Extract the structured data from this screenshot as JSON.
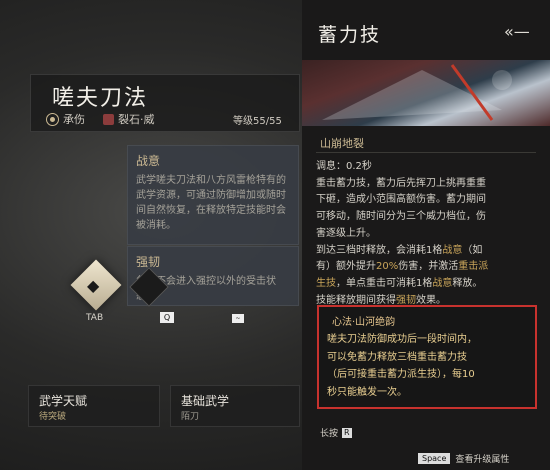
{
  "skill": {
    "title": "嗟夫刀法",
    "attr1": "承伤",
    "attr2": "裂石·威",
    "level": "等级55/55"
  },
  "tooltips": [
    {
      "heading": "战意",
      "body": "武学嗟夫刀法和八方风雷枪特有的武学资源，可通过防御增加或随时间自然恢复，在释放特定技能时会被消耗。"
    },
    {
      "heading": "强韧",
      "body": "角色不会进入强控以外的受击状态。"
    }
  ],
  "keys": {
    "tab": "TAB",
    "q": "Q",
    "tilde": "~"
  },
  "cards": [
    {
      "title": "武学天赋",
      "sub": "待突破"
    },
    {
      "title": "基础武学",
      "sub": "陌刀"
    }
  ],
  "panel": {
    "heading": "蓄力技",
    "section": "山崩地裂",
    "lines": [
      "调息：0.2秒",
      "重击蓄力技，蓄力后先挥刀上挑再重重下砸，造成小范围高额伤害。蓄力期间可移动，随时间分为三个威力档位，伤害逐级上升。",
      "到达三档时释放，会消耗1格战意（如有）额外提升20%伤害，并激活重击派生技，单点重击可消耗1格战意释放。",
      "技能释放期间获得强韧效果。"
    ],
    "rows": [
      [
        "调息：0.2秒"
      ],
      [
        "重击蓄力技，蓄力后先挥刀上挑再重重"
      ],
      [
        "下砸，造成小范围高额伤害。蓄力期间"
      ],
      [
        "可移动，随时间分为三个威力档位，伤"
      ],
      [
        "害逐级上升。"
      ],
      [
        "到达三档时释放，会消耗1格",
        "战意",
        "（如"
      ],
      [
        "有）额外提升",
        "20%",
        "伤害，并激活",
        "重击派"
      ],
      [
        "生技",
        "，单点重击可消耗1格",
        "战意",
        "释放。"
      ],
      [
        "技能释放期间获得",
        "强韧",
        "效果。"
      ]
    ],
    "highlight_color": "#c9a55a"
  },
  "mindset": {
    "title": "心法·山河绝韵",
    "lines": [
      "嗟夫刀法防御成功后一段时间内，",
      "可以免蓄力释放三档重击蓄力技",
      "（后可接重击蓄力派生技），每10",
      "秒只能触发一次。"
    ]
  },
  "longpress": {
    "label": "长按",
    "key": "R"
  },
  "footer": {
    "key": "Space",
    "label": "查看升级属性"
  }
}
